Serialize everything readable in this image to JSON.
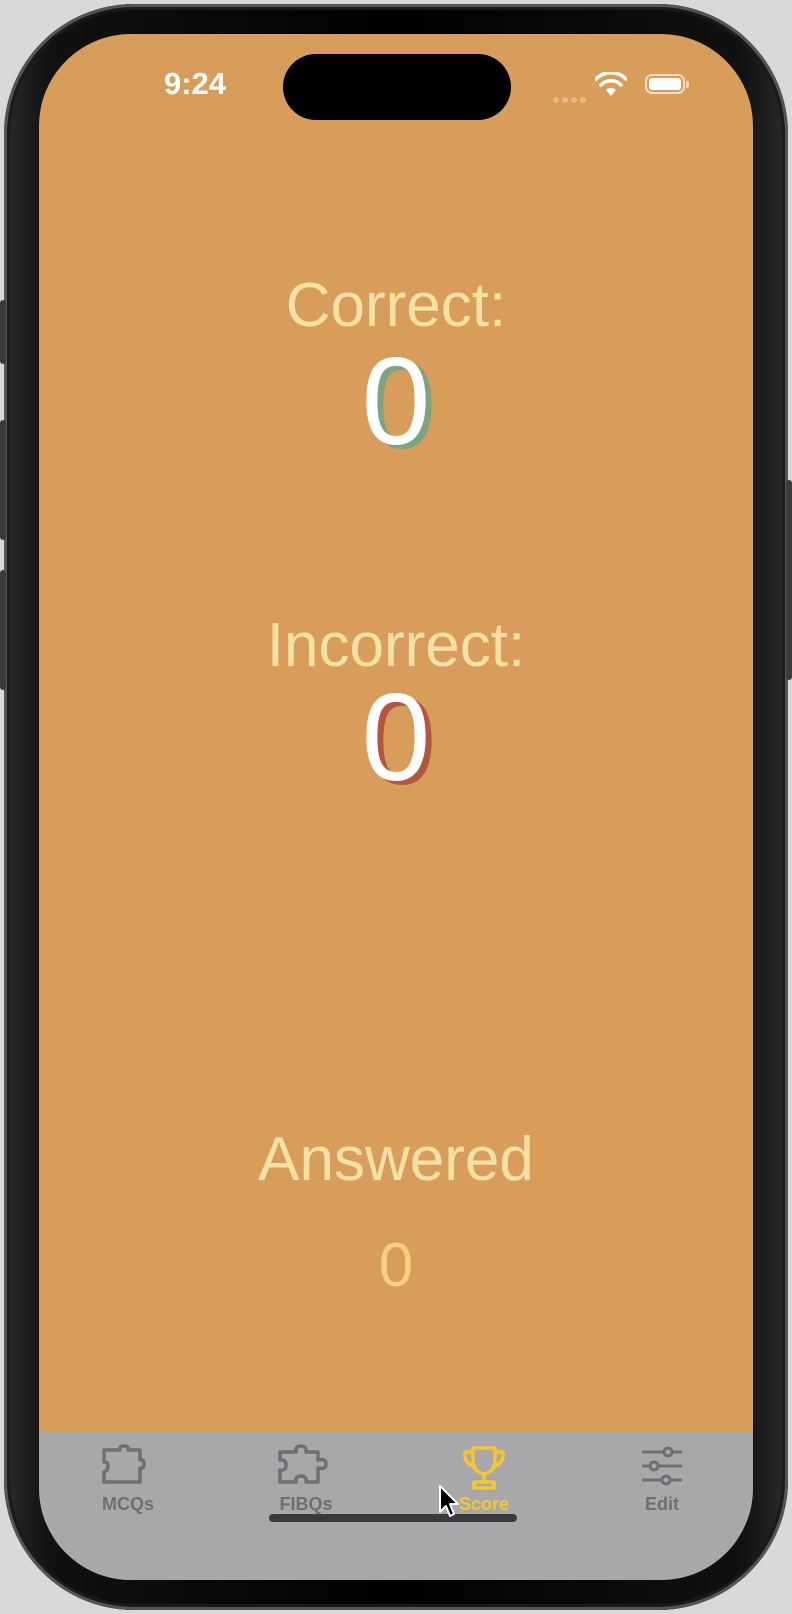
{
  "status_bar": {
    "time": "9:24"
  },
  "score": {
    "correct_label": "Correct:",
    "correct_value": "0",
    "incorrect_label": "Incorrect:",
    "incorrect_value": "0",
    "answered_label": "Answered",
    "answered_value": "0"
  },
  "tabbar": {
    "tabs": [
      {
        "label": "MCQs",
        "icon": "puzzle-piece-icon",
        "active": false
      },
      {
        "label": "FIBQs",
        "icon": "puzzle-icon",
        "active": false
      },
      {
        "label": "Score",
        "icon": "trophy-icon",
        "active": true
      },
      {
        "label": "Edit",
        "icon": "sliders-icon",
        "active": false
      }
    ]
  },
  "colors": {
    "background": "#d99d5b",
    "label_text": "#f5e1a6",
    "correct_shadow": "#7ea37f",
    "incorrect_shadow": "#b4553f",
    "tabbar_background": "#a8a8ab",
    "active_tab": "#f6c72c",
    "inactive_tab": "#6f6f73"
  }
}
